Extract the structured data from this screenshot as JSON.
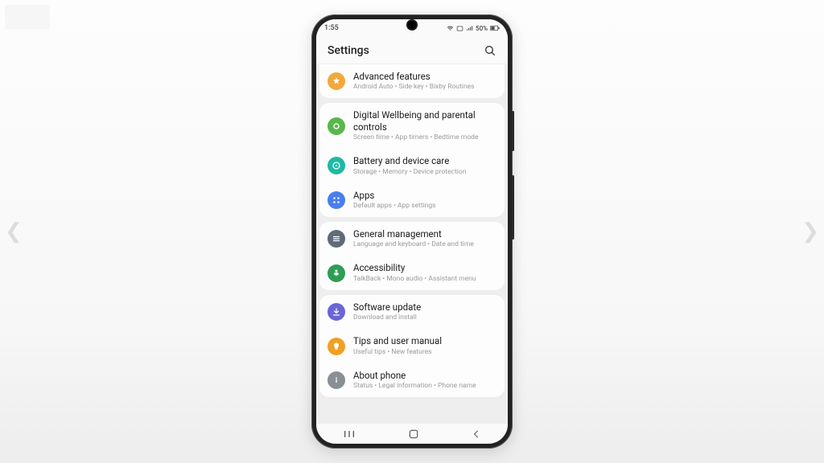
{
  "status": {
    "time": "1:55",
    "battery": "50%"
  },
  "header": {
    "title": "Settings"
  },
  "groups": [
    {
      "items": [
        {
          "title": "Advanced features",
          "sub": "Android Auto  •  Side key  •  Bixby Routines",
          "iconColor": "#f2a93b",
          "iconGlyph": "star"
        }
      ]
    },
    {
      "items": [
        {
          "title": "Digital Wellbeing and parental controls",
          "sub": "Screen time  •  App timers  •  Bedtime mode",
          "iconColor": "#57b84b",
          "iconGlyph": "ring"
        },
        {
          "title": "Battery and device care",
          "sub": "Storage  •  Memory  •  Device protection",
          "iconColor": "#1fb9a3",
          "iconGlyph": "pulse"
        },
        {
          "title": "Apps",
          "sub": "Default apps  •  App settings",
          "iconColor": "#4a7ef0",
          "iconGlyph": "grid"
        }
      ]
    },
    {
      "items": [
        {
          "title": "General management",
          "sub": "Language and keyboard  •  Date and time",
          "iconColor": "#5f6b7a",
          "iconGlyph": "lines"
        },
        {
          "title": "Accessibility",
          "sub": "TalkBack  •  Mono audio  •  Assistant menu",
          "iconColor": "#2e9e55",
          "iconGlyph": "person"
        }
      ]
    },
    {
      "items": [
        {
          "title": "Software update",
          "sub": "Download and install",
          "iconColor": "#6a65d8",
          "iconGlyph": "download"
        },
        {
          "title": "Tips and user manual",
          "sub": "Useful tips  •  New features",
          "iconColor": "#f0a024",
          "iconGlyph": "bulb"
        },
        {
          "title": "About phone",
          "sub": "Status  •  Legal information  •  Phone name",
          "iconColor": "#8a8f96",
          "iconGlyph": "info"
        }
      ]
    }
  ]
}
